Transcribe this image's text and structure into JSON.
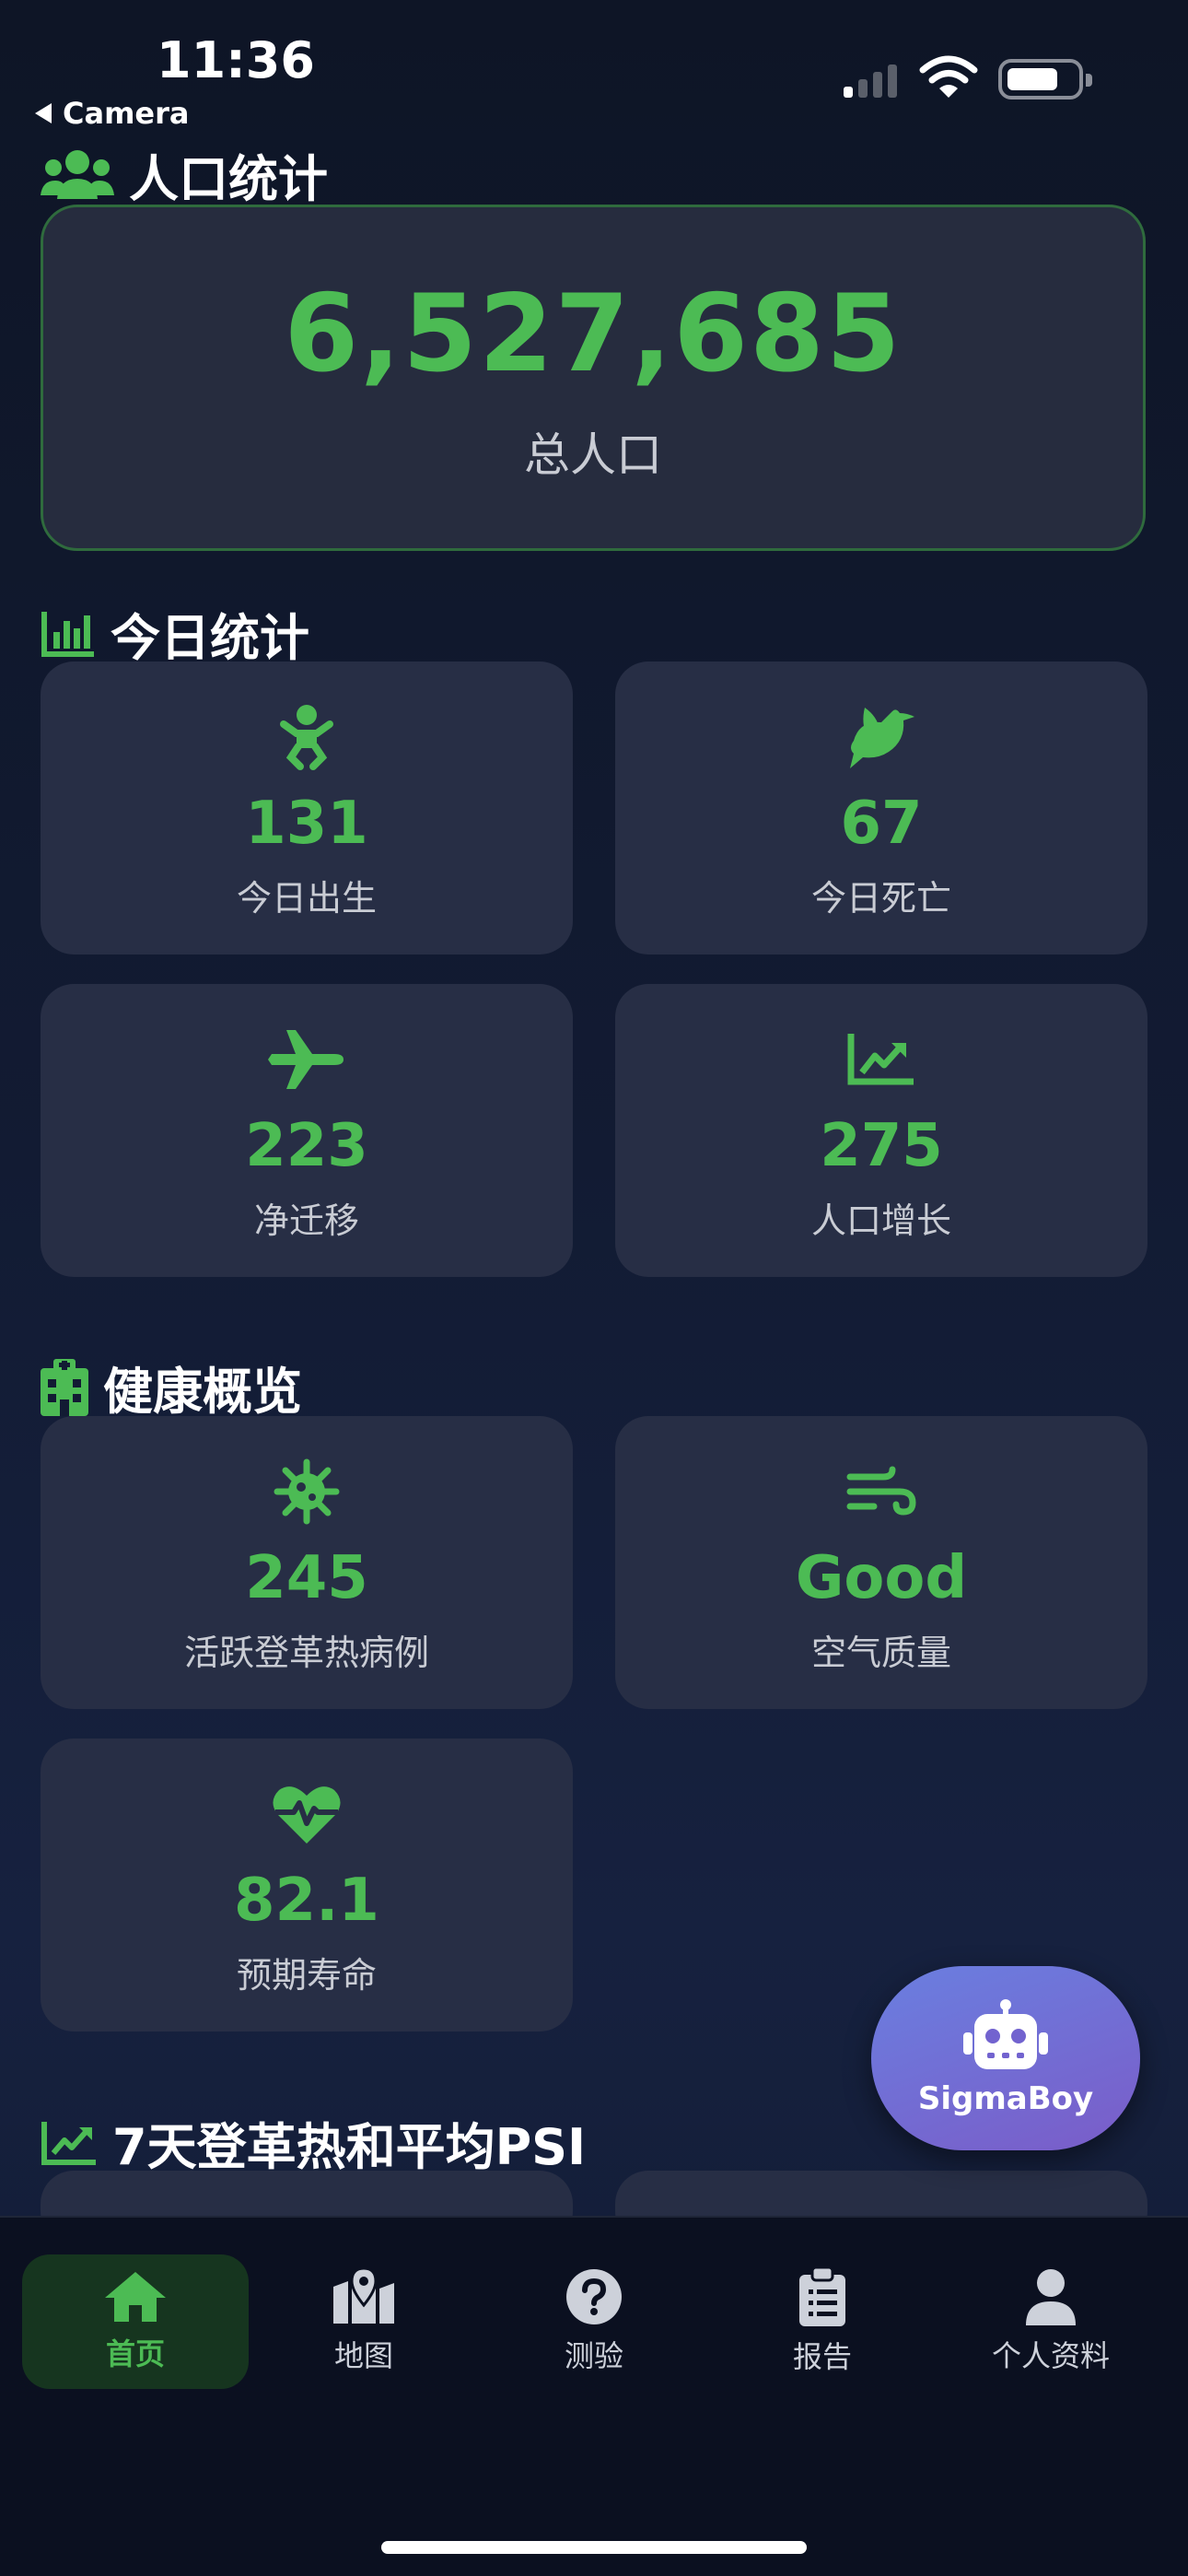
{
  "status_bar": {
    "time": "11:36",
    "back_app": "Camera"
  },
  "population": {
    "section_title": "人口统计",
    "total": "6,527,685",
    "label": "总人口"
  },
  "today": {
    "section_title": "今日统计",
    "cards": [
      {
        "icon": "baby-icon",
        "value": "131",
        "label": "今日出生"
      },
      {
        "icon": "dove-icon",
        "value": "67",
        "label": "今日死亡"
      },
      {
        "icon": "airplane-icon",
        "value": "223",
        "label": "净迁移"
      },
      {
        "icon": "chart-line-icon",
        "value": "275",
        "label": "人口增长"
      }
    ]
  },
  "health": {
    "section_title": "健康概览",
    "cards": [
      {
        "icon": "virus-icon",
        "value": "245",
        "label": "活跃登革热病例"
      },
      {
        "icon": "wind-icon",
        "value": "Good",
        "label": "空气质量"
      },
      {
        "icon": "heart-pulse-icon",
        "value": "82.1",
        "label": "预期寿命"
      }
    ]
  },
  "trend": {
    "section_title": "7天登革热和平均PSI"
  },
  "fab": {
    "icon": "robot-icon",
    "label": "SigmaBoy"
  },
  "tabs": [
    {
      "icon": "home-icon",
      "label": "首页",
      "active": true
    },
    {
      "icon": "map-icon",
      "label": "地图",
      "active": false
    },
    {
      "icon": "question-icon",
      "label": "测验",
      "active": false
    },
    {
      "icon": "clipboard-icon",
      "label": "报告",
      "active": false
    },
    {
      "icon": "user-icon",
      "label": "个人资料",
      "active": false
    }
  ],
  "colors": {
    "accent": "#4cbb54",
    "card": "#272e45",
    "background": "#121b33",
    "fab": "#7a5cc8"
  }
}
